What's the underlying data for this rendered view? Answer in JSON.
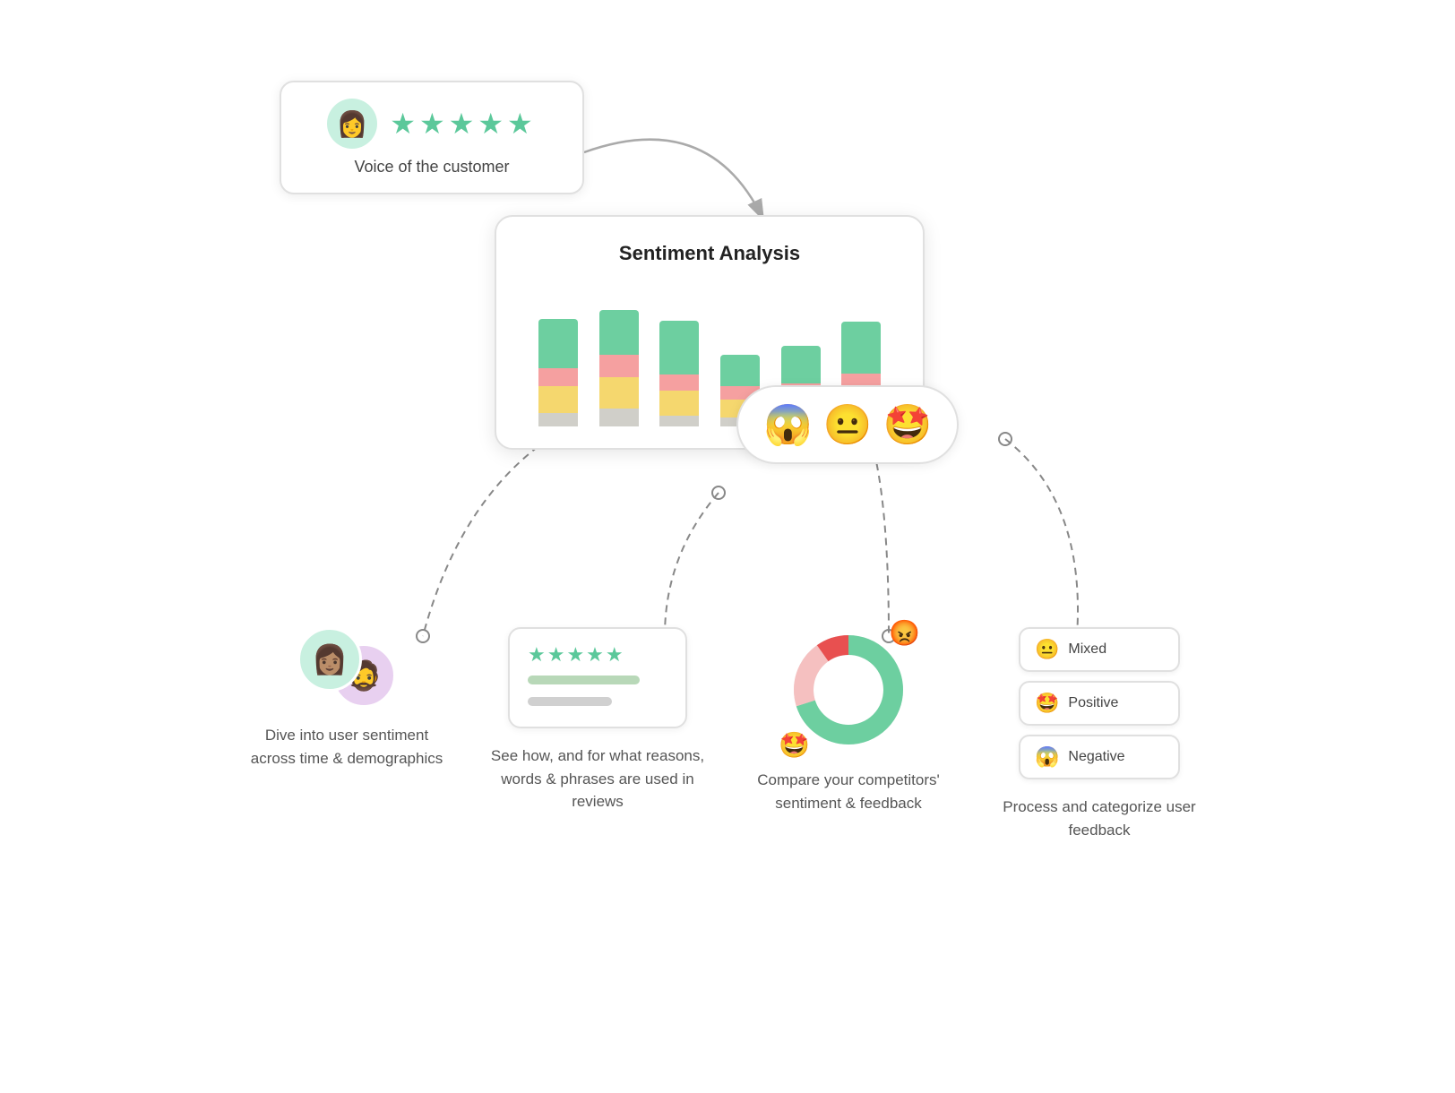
{
  "voc": {
    "label": "Voice of the customer",
    "stars": "★★★★★",
    "avatar_emoji": "👩"
  },
  "sentiment": {
    "title": "Sentiment Analysis",
    "emojis": [
      "😱",
      "😐",
      "🤩"
    ],
    "bars": [
      {
        "green": 55,
        "pink": 20,
        "yellow": 30,
        "gray": 15
      },
      {
        "green": 50,
        "pink": 25,
        "yellow": 35,
        "gray": 20
      },
      {
        "green": 60,
        "pink": 18,
        "yellow": 28,
        "gray": 12
      },
      {
        "green": 35,
        "pink": 15,
        "yellow": 20,
        "gray": 10
      },
      {
        "green": 42,
        "pink": 22,
        "yellow": 18,
        "gray": 8
      },
      {
        "green": 58,
        "pink": 20,
        "yellow": 25,
        "gray": 14
      }
    ]
  },
  "features": [
    {
      "id": "demographics",
      "text": "Dive into user sentiment across time & demographics"
    },
    {
      "id": "reviews",
      "text": "See how, and for what reasons, words & phrases are used in reviews"
    },
    {
      "id": "competitors",
      "text": "Compare your competitors' sentiment & feedback"
    },
    {
      "id": "categorize",
      "text": "Process and categorize user feedback"
    }
  ],
  "legend": [
    {
      "emoji": "😐",
      "label": "Mixed"
    },
    {
      "emoji": "🤩",
      "label": "Positive"
    },
    {
      "emoji": "😱",
      "label": "Negative"
    }
  ]
}
